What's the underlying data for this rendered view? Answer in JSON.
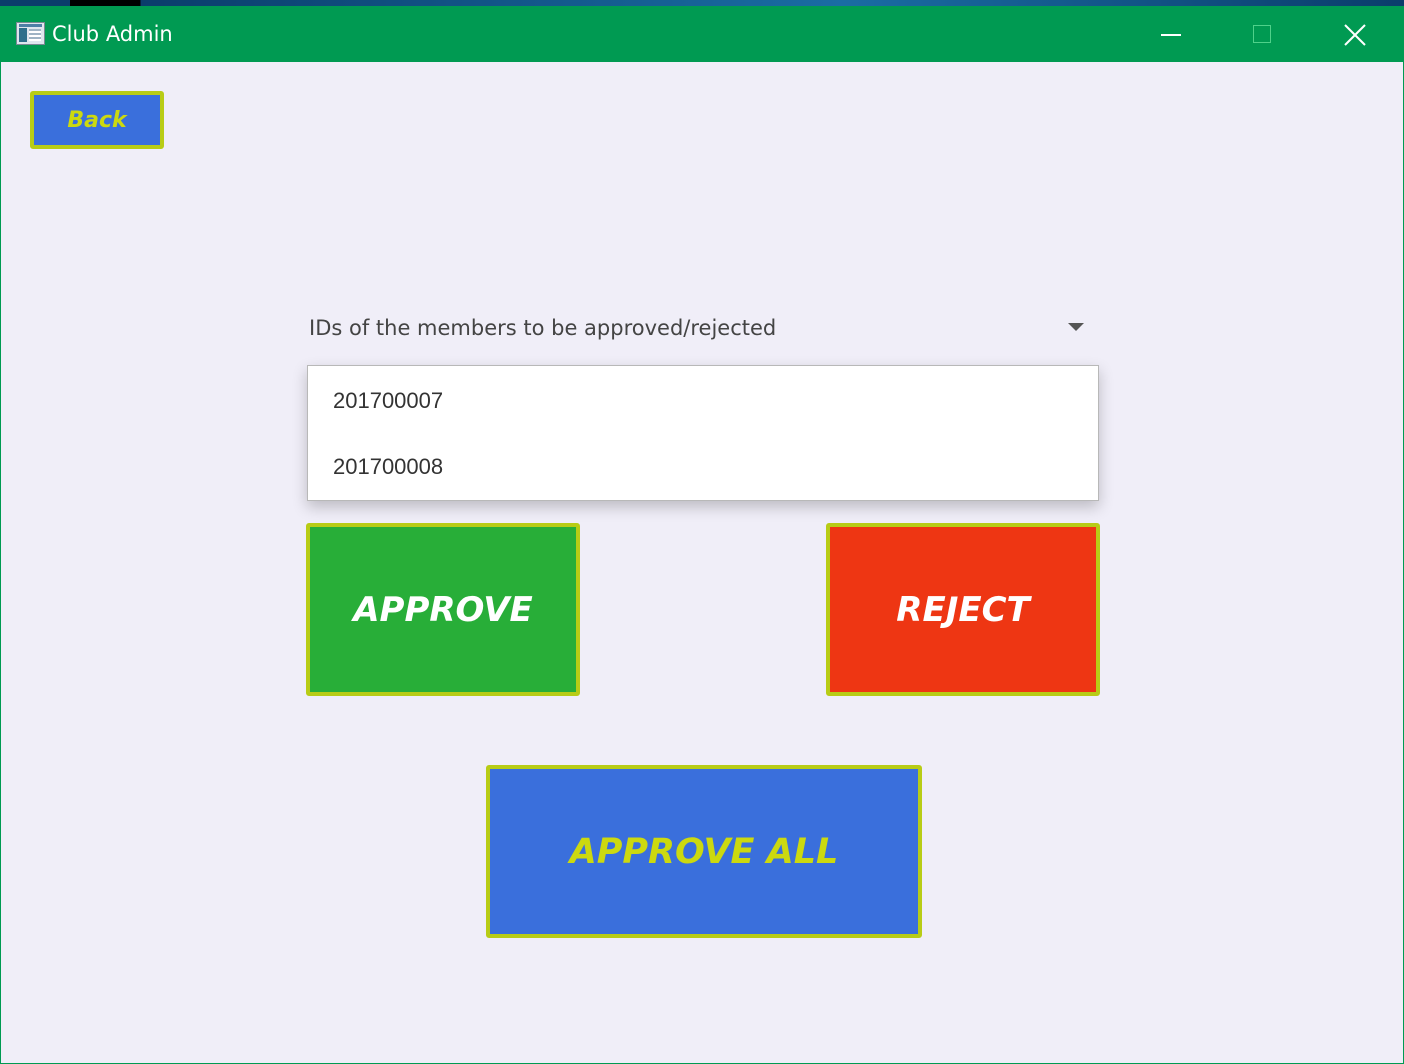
{
  "window": {
    "title": "Club Admin",
    "titlebar_color": "#009a52",
    "controls": [
      "minimize-icon",
      "maximize-icon",
      "close-icon"
    ]
  },
  "back_button": {
    "label": "Back",
    "color": "#3a6fdc"
  },
  "member_select": {
    "prompt": "IDs of the members to be approved/rejected",
    "expanded": true,
    "options": [
      "201700007",
      "201700008"
    ]
  },
  "actions": {
    "approve_label": "APPROVE",
    "approve_color": "#28ae38",
    "reject_label": "REJECT",
    "reject_color": "#ee3613",
    "approve_all_label": "APPROVE ALL",
    "approve_all_color": "#3a6fdc",
    "border_color": "#b8cc16"
  }
}
